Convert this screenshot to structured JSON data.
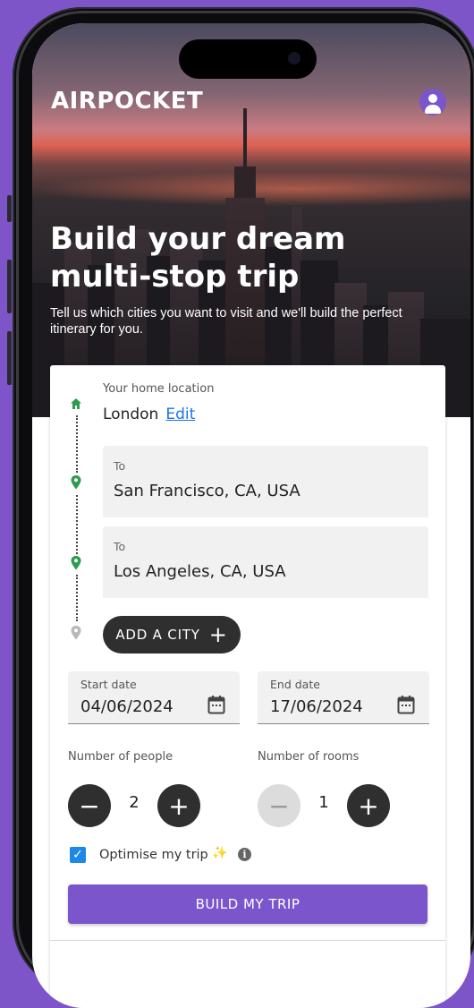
{
  "app": {
    "brand": "AIRPOCKET",
    "accent_color": "#7b55cc"
  },
  "hero": {
    "title_line1": "Build your dream",
    "title_line2": "multi-stop trip",
    "subtitle": "Tell us which cities you want to visit and we'll build the perfect itinerary for you."
  },
  "header": {
    "profile_icon": "account-circle-icon"
  },
  "form": {
    "home": {
      "label": "Your home location",
      "value": "London",
      "edit_label": "Edit"
    },
    "destinations": [
      {
        "label": "To",
        "value": "San Francisco, CA, USA"
      },
      {
        "label": "To",
        "value": "Los Angeles, CA, USA"
      }
    ],
    "add_city_label": "ADD A CITY",
    "start_date": {
      "label": "Start date",
      "value": "04/06/2024"
    },
    "end_date": {
      "label": "End date",
      "value": "17/06/2024"
    },
    "people": {
      "label": "Number of people",
      "value": "2",
      "minus": "−",
      "plus": "+"
    },
    "rooms": {
      "label": "Number of rooms",
      "value": "1",
      "minus": "−",
      "plus": "+"
    },
    "optimise": {
      "label": "Optimise my trip",
      "checked": true,
      "sparkle": "✨",
      "info": "i"
    },
    "submit_label": "BUILD MY TRIP"
  },
  "icons": {
    "home": "home-icon",
    "pin": "location-pin-icon",
    "calendar": "calendar-icon",
    "check": "✓",
    "add": "+"
  },
  "colors": {
    "pin_active": "#2e9b4e",
    "pin_inactive": "#b8b8b8",
    "checkbox": "#1e88e5"
  }
}
